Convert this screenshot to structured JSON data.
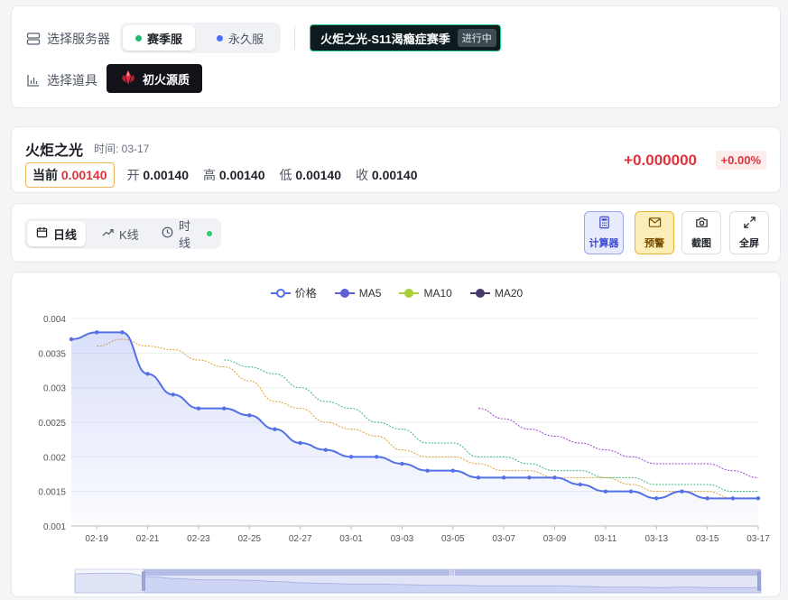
{
  "server": {
    "label": "选择服务器",
    "options": [
      {
        "label": "赛季服",
        "active": true,
        "dot_color": "#22b66e"
      },
      {
        "label": "永久服",
        "active": false,
        "dot_color": "#4f6ef7"
      }
    ],
    "season_name": "火炬之光-S11渴瘾症赛季",
    "season_status": "进行中"
  },
  "item": {
    "label": "选择道具",
    "selected": "初火源质",
    "icon": "crystal-icon"
  },
  "info": {
    "title": "火炬之光",
    "time": "时间: 03-17",
    "current_label": "当前",
    "current_value": "0.00140",
    "open_label": "开",
    "open_value": "0.00140",
    "high_label": "高",
    "high_value": "0.00140",
    "low_label": "低",
    "low_value": "0.00140",
    "close_label": "收",
    "close_value": "0.00140",
    "change": "+0.000000",
    "change_pct": "+0.00%"
  },
  "toolbar": {
    "tabs": [
      {
        "label": "日线",
        "icon": "calendar-icon",
        "active": true
      },
      {
        "label": "K线",
        "icon": "trend-icon",
        "active": false
      },
      {
        "label": "时线",
        "icon": "clock-icon",
        "active": false,
        "live_dot": true
      }
    ],
    "tools": [
      {
        "label": "计算器",
        "icon": "calculator-icon"
      },
      {
        "label": "预警",
        "icon": "mail-icon"
      },
      {
        "label": "截图",
        "icon": "camera-icon"
      },
      {
        "label": "全屏",
        "icon": "expand-icon"
      }
    ]
  },
  "colors": {
    "price": "#5470e6",
    "ma5": "#e0a030",
    "ma10": "#3cba78",
    "ma20": "#a040d0",
    "accent_red": "#e0323c"
  },
  "chart_data": {
    "type": "line",
    "legend": [
      "价格",
      "MA5",
      "MA10",
      "MA20"
    ],
    "legend_position": "top-center",
    "x": [
      "02-18",
      "02-19",
      "02-20",
      "02-21",
      "02-22",
      "02-23",
      "02-24",
      "02-25",
      "02-26",
      "02-27",
      "02-28",
      "03-01",
      "03-02",
      "03-03",
      "03-04",
      "03-05",
      "03-06",
      "03-07",
      "03-08",
      "03-09",
      "03-10",
      "03-11",
      "03-12",
      "03-13",
      "03-14",
      "03-15",
      "03-16",
      "03-17"
    ],
    "x_tick_labels": [
      "02-19",
      "02-21",
      "02-23",
      "02-25",
      "02-27",
      "03-01",
      "03-03",
      "03-05",
      "03-07",
      "03-09",
      "03-11",
      "03-13",
      "03-15",
      "03-17"
    ],
    "ylim": [
      0.001,
      0.004
    ],
    "y_ticks": [
      "0.004",
      "0.0035",
      "0.003",
      "0.0025",
      "0.002",
      "0.0015",
      "0.001"
    ],
    "series": [
      {
        "name": "价格",
        "values": [
          0.0037,
          0.0038,
          0.0038,
          0.0032,
          0.0029,
          0.0027,
          0.0027,
          0.0026,
          0.0024,
          0.0022,
          0.0021,
          0.002,
          0.002,
          0.0019,
          0.0018,
          0.0018,
          0.0017,
          0.0017,
          0.0017,
          0.0017,
          0.0016,
          0.0015,
          0.0015,
          0.0014,
          0.0015,
          0.0014,
          0.0014,
          0.0014
        ]
      },
      {
        "name": "MA5",
        "values": [
          null,
          0.0036,
          0.0037,
          0.0036,
          0.00355,
          0.0034,
          0.0033,
          0.0031,
          0.0028,
          0.0027,
          0.0025,
          0.0024,
          0.0023,
          0.0021,
          0.002,
          0.002,
          0.0019,
          0.0018,
          0.0018,
          0.0017,
          0.0017,
          0.0017,
          0.0016,
          0.0015,
          0.0015,
          0.0015,
          0.0014,
          0.0014
        ]
      },
      {
        "name": "MA10",
        "values": [
          null,
          null,
          null,
          null,
          null,
          null,
          0.0034,
          0.0033,
          0.0032,
          0.003,
          0.0028,
          0.0027,
          0.0025,
          0.0024,
          0.0022,
          0.0022,
          0.002,
          0.002,
          0.0019,
          0.0018,
          0.0018,
          0.0017,
          0.0017,
          0.0016,
          0.0016,
          0.0016,
          0.0015,
          0.0015
        ]
      },
      {
        "name": "MA20",
        "values": [
          null,
          null,
          null,
          null,
          null,
          null,
          null,
          null,
          null,
          null,
          null,
          null,
          null,
          null,
          null,
          null,
          0.0027,
          0.00255,
          0.0024,
          0.0023,
          0.0022,
          0.0021,
          0.002,
          0.0019,
          0.0019,
          0.0019,
          0.0018,
          0.0017
        ]
      }
    ],
    "grid": true,
    "area_fill": true,
    "zoom_slider": true
  }
}
